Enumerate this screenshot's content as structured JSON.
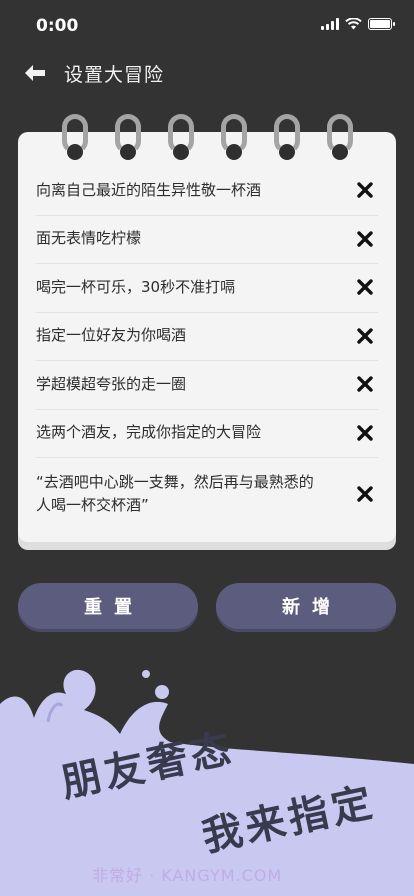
{
  "status_bar": {
    "time": "0:00"
  },
  "header": {
    "title": "设置大冒险"
  },
  "dares": [
    {
      "text": "向离自己最近的陌生异性敬一杯酒"
    },
    {
      "text": "面无表情吃柠檬"
    },
    {
      "text": "喝完一杯可乐，30秒不准打嗝"
    },
    {
      "text": "指定一位好友为你喝酒"
    },
    {
      "text": "学超模超夸张的走一圈"
    },
    {
      "text": "选两个酒友，完成你指定的大冒险"
    },
    {
      "text": "“去酒吧中心跳一支舞，然后再与最熟悉的人喝一杯交杯酒”"
    }
  ],
  "buttons": {
    "reset": "重置",
    "add": "新增"
  },
  "slogan": {
    "line1": "朋友奢态",
    "line2": "我来指定"
  },
  "watermark": "非常好 · KANGYM.COM",
  "colors": {
    "background": "#333333",
    "button": "#5c5c7e",
    "splash": "#c9c8f0"
  }
}
